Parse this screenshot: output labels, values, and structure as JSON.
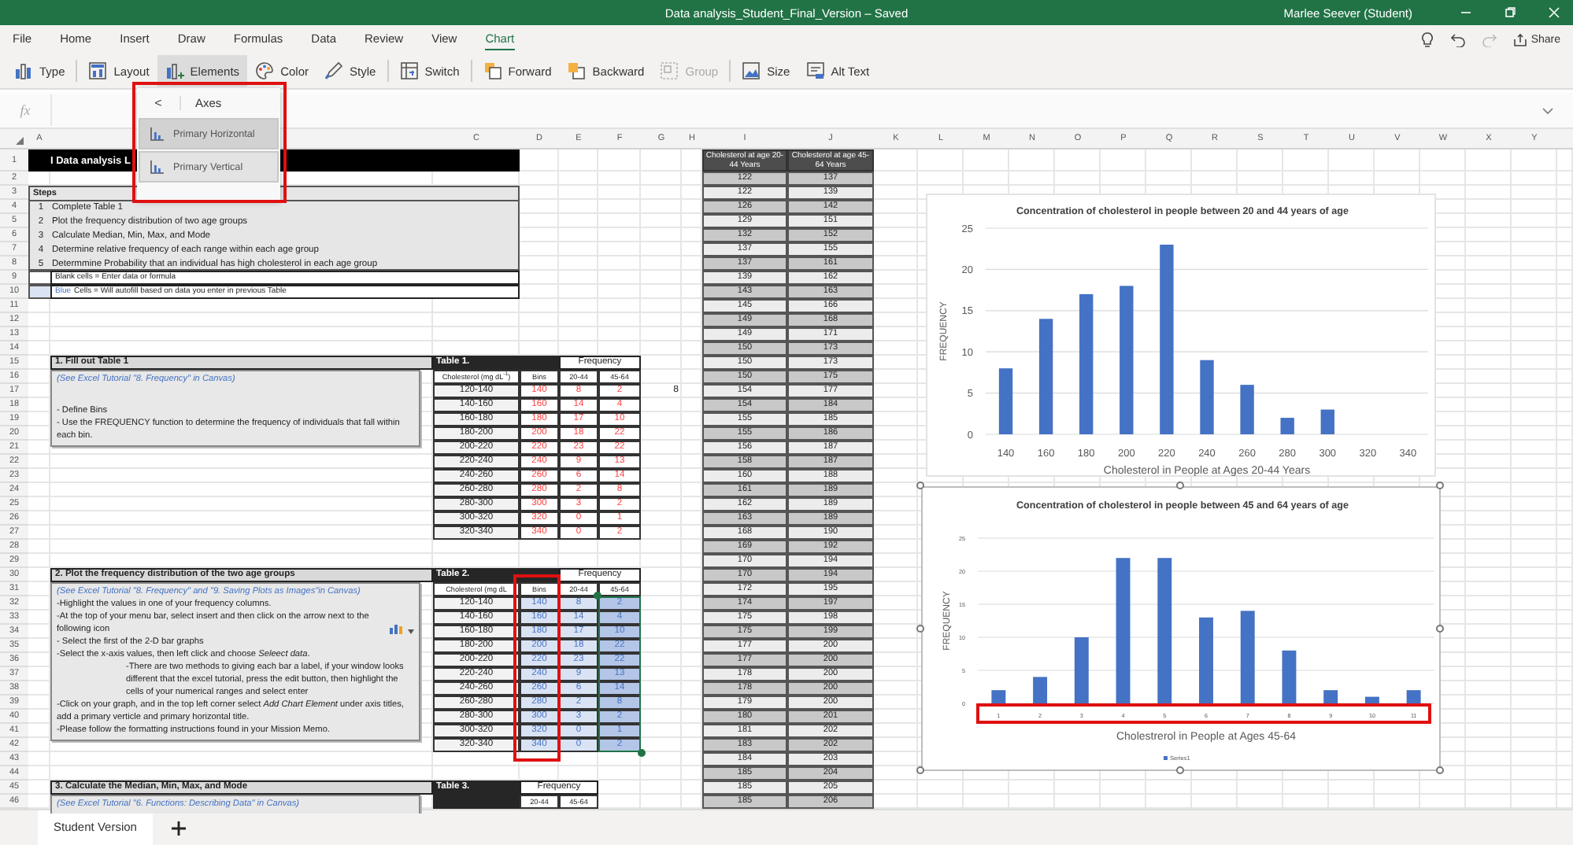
{
  "window": {
    "title": "Data analysis_Student_Final_Version – Saved",
    "user": "Marlee Seever (Student)"
  },
  "menu_tabs": [
    {
      "label": "File",
      "selected": false
    },
    {
      "label": "Home",
      "selected": false
    },
    {
      "label": "Insert",
      "selected": false
    },
    {
      "label": "Draw",
      "selected": false
    },
    {
      "label": "Formulas",
      "selected": false
    },
    {
      "label": "Data",
      "selected": false
    },
    {
      "label": "Review",
      "selected": false
    },
    {
      "label": "View",
      "selected": false
    },
    {
      "label": "Chart",
      "selected": true
    }
  ],
  "share": "Share",
  "ribbon": [
    {
      "label": "Type",
      "kind": "type",
      "active": false,
      "disabled": false
    },
    {
      "label": "Layout",
      "kind": "layout",
      "active": false,
      "disabled": false
    },
    {
      "label": "Elements",
      "kind": "elements",
      "active": true,
      "disabled": false
    },
    {
      "label": "Color",
      "kind": "color",
      "active": false,
      "disabled": false
    },
    {
      "label": "Style",
      "kind": "style",
      "active": false,
      "disabled": false
    },
    {
      "label": "Switch",
      "kind": "switch",
      "active": false,
      "disabled": false
    },
    {
      "label": "Forward",
      "kind": "forward",
      "active": false,
      "disabled": false
    },
    {
      "label": "Backward",
      "kind": "backward",
      "active": false,
      "disabled": false
    },
    {
      "label": "Group",
      "kind": "group",
      "active": false,
      "disabled": true
    },
    {
      "label": "Size",
      "kind": "size",
      "active": false,
      "disabled": false
    },
    {
      "label": "Alt Text",
      "kind": "alttext",
      "active": false,
      "disabled": false
    }
  ],
  "formula_bar": {
    "label": "fx"
  },
  "dropdown": {
    "back": "<",
    "title": "Axes",
    "items": [
      {
        "label": "Primary Horizontal",
        "selected": true
      },
      {
        "label": "Primary Vertical",
        "selected": false
      }
    ]
  },
  "column_headers": [
    "A",
    "C",
    "D",
    "E",
    "F",
    "G",
    "H",
    "I",
    "J",
    "K",
    "L",
    "M",
    "N",
    "O",
    "P",
    "Q",
    "R",
    "S",
    "T",
    "U",
    "V",
    "W",
    "X",
    "Y"
  ],
  "row_numbers": [
    "1",
    "2",
    "3",
    "4",
    "5",
    "6",
    "7",
    "8",
    "9",
    "10",
    "11",
    "12",
    "13",
    "14",
    "15",
    "16",
    "17",
    "18",
    "19",
    "20",
    "21",
    "22",
    "23",
    "24",
    "25",
    "26",
    "27",
    "28",
    "29",
    "30",
    "31",
    "32",
    "33",
    "34",
    "35",
    "36",
    "37",
    "38",
    "39",
    "40",
    "41",
    "42",
    "43",
    "44",
    "45",
    "46"
  ],
  "sheet_title": "I Data analysis L",
  "steps": {
    "heading": "Steps",
    "items": [
      {
        "number": "1",
        "text": "Complete Table 1"
      },
      {
        "number": "2",
        "text": "Plot the frequency distribution of two age groups"
      },
      {
        "number": "3",
        "text": "Calculate Median, Min, Max, and Mode"
      },
      {
        "number": "4",
        "text": "Determine relative frequency of each range within each age group"
      },
      {
        "number": "5",
        "text": "Determmine Probability that an individual has high cholesterol in each age group"
      }
    ]
  },
  "legend": [
    {
      "color": "#ffffff",
      "text": "Blank cells = Enter data or formula"
    },
    {
      "color": "#dae3f3",
      "highlight": "Blue",
      "text": "Cells = Will autofill based on data you enter in previous Table"
    }
  ],
  "sections": [
    {
      "heading": "1. Fill out Table 1",
      "note": "(See Excel Tutorial \"8. Frequency\" in Canvas)",
      "lines": [
        {
          "kind": "plain",
          "text": "- Define Bins"
        },
        {
          "kind": "plain",
          "text": "- Use the FREQUENCY function to determine the frequency of individuals that fall within each bin."
        }
      ]
    },
    {
      "heading": "2. Plot the frequency distribution of the two age groups",
      "note": "(See Excel Tutorial \"8. Frequency\" and \"9. Saving Plots as Images\"in Canvas)",
      "lines": [
        {
          "kind": "plain",
          "text": "-Highlight the values in one of your frequency columns."
        },
        {
          "kind": "icon",
          "text": "-At the top of your menu bar, select insert and then click on the arrow next to the following icon"
        },
        {
          "kind": "plain",
          "text": "- Select the first of the 2-D bar graphs"
        },
        {
          "kind": "plain",
          "text": "-Select the x-axis values, then left click and choose *Seleect data*."
        },
        {
          "kind": "indent",
          "text": "-There are two methods to giving each bar a label, if your window looks different that the excel tutorial, press the edit button, then highlight the cells of your numerical ranges and select enter"
        },
        {
          "kind": "plain",
          "text": "-Click on your graph, and in the top left corner select *Add Chart Element* under axis titles, add a primary verticle and primary horizontal title."
        },
        {
          "kind": "plain",
          "text": "-Please follow the formatting instructions found in your Mission Memo."
        }
      ]
    },
    {
      "heading": "3. Calculate the Median, Min, Max, and Mode",
      "note": "(See Excel Tutorial \"6. Functions: Describing Data\" in Canvas)"
    }
  ],
  "tables": [
    {
      "title": "Table 1.",
      "group": "Frequency",
      "kind": "entry",
      "columns": [
        {
          "label": "Cholesterol (mg dL$^{-1}$)",
          "selected": false
        },
        {
          "label": "Bins",
          "selected": false
        },
        {
          "label": "20-44",
          "selected": false
        },
        {
          "label": "45-64",
          "selected": false
        }
      ],
      "rows": [
        [
          "120-140",
          "140",
          "8",
          "2"
        ],
        [
          "140-160",
          "160",
          "14",
          "4"
        ],
        [
          "160-180",
          "180",
          "17",
          "10"
        ],
        [
          "180-200",
          "200",
          "18",
          "22"
        ],
        [
          "200-220",
          "220",
          "23",
          "22"
        ],
        [
          "220-240",
          "240",
          "9",
          "13"
        ],
        [
          "240-260",
          "260",
          "6",
          "14"
        ],
        [
          "260-280",
          "280",
          "2",
          "8"
        ],
        [
          "280-300",
          "300",
          "3",
          "2"
        ],
        [
          "300-320",
          "320",
          "0",
          "1"
        ],
        [
          "320-340",
          "340",
          "0",
          "2"
        ]
      ]
    },
    {
      "title": "Table 2.",
      "group": "Frequency",
      "kind": "autofill",
      "columns": [
        {
          "label": "Cholesterol (mg dL",
          "selected": false
        },
        {
          "label": "Bins",
          "selected": false
        },
        {
          "label": "20-44",
          "selected": false
        },
        {
          "label": "45-64",
          "selected": true
        }
      ],
      "rows": [
        [
          "120-140",
          "140",
          "8",
          "2"
        ],
        [
          "140-160",
          "160",
          "14",
          "4"
        ],
        [
          "160-180",
          "180",
          "17",
          "10"
        ],
        [
          "180-200",
          "200",
          "18",
          "22"
        ],
        [
          "200-220",
          "220",
          "23",
          "22"
        ],
        [
          "220-240",
          "240",
          "9",
          "13"
        ],
        [
          "240-260",
          "260",
          "6",
          "14"
        ],
        [
          "260-280",
          "280",
          "2",
          "8"
        ],
        [
          "280-300",
          "300",
          "3",
          "2"
        ],
        [
          "300-320",
          "320",
          "0",
          "1"
        ],
        [
          "320-340",
          "340",
          "0",
          "2"
        ]
      ]
    },
    {
      "title": "Table 3.",
      "group": "Frequency",
      "kind": "summary",
      "columns": [
        {
          "label": "20-44"
        },
        {
          "label": "45-64"
        }
      ]
    }
  ],
  "stray_value": "8",
  "data_columns": {
    "headers": [
      "Cholesterol at age 20-44 Years",
      "Cholesterol at age 45-64 Years"
    ],
    "rows": [
      [
        "122",
        "137"
      ],
      [
        "122",
        "139"
      ],
      [
        "126",
        "142"
      ],
      [
        "129",
        "151"
      ],
      [
        "132",
        "152"
      ],
      [
        "137",
        "155"
      ],
      [
        "137",
        "161"
      ],
      [
        "139",
        "162"
      ],
      [
        "143",
        "163"
      ],
      [
        "145",
        "166"
      ],
      [
        "149",
        "168"
      ],
      [
        "149",
        "171"
      ],
      [
        "150",
        "173"
      ],
      [
        "150",
        "173"
      ],
      [
        "150",
        "175"
      ],
      [
        "154",
        "177"
      ],
      [
        "154",
        "184"
      ],
      [
        "155",
        "185"
      ],
      [
        "155",
        "186"
      ],
      [
        "156",
        "187"
      ],
      [
        "158",
        "187"
      ],
      [
        "160",
        "188"
      ],
      [
        "161",
        "189"
      ],
      [
        "162",
        "189"
      ],
      [
        "163",
        "189"
      ],
      [
        "168",
        "190"
      ],
      [
        "169",
        "192"
      ],
      [
        "170",
        "194"
      ],
      [
        "170",
        "194"
      ],
      [
        "172",
        "195"
      ],
      [
        "174",
        "197"
      ],
      [
        "175",
        "198"
      ],
      [
        "175",
        "199"
      ],
      [
        "177",
        "200"
      ],
      [
        "177",
        "200"
      ],
      [
        "178",
        "200"
      ],
      [
        "178",
        "200"
      ],
      [
        "179",
        "200"
      ],
      [
        "180",
        "201"
      ],
      [
        "181",
        "202"
      ],
      [
        "183",
        "202"
      ],
      [
        "184",
        "203"
      ],
      [
        "185",
        "204"
      ],
      [
        "185",
        "205"
      ],
      [
        "185",
        "206"
      ]
    ]
  },
  "charts": [
    {
      "selected": false,
      "chart_data": {
        "type": "bar",
        "title": "Concentration of cholesterol in people between 20 and 44 years of age",
        "xlabel": "Cholesterol in People at Ages 20-44 Years",
        "ylabel": "FREQUENCY",
        "categories": [
          "140",
          "160",
          "180",
          "200",
          "220",
          "240",
          "260",
          "280",
          "300",
          "320",
          "340"
        ],
        "values": [
          8,
          14,
          17,
          18,
          23,
          9,
          6,
          2,
          3,
          0,
          0
        ],
        "grid": true,
        "ylim": [
          0,
          25
        ],
        "yticks": [
          0,
          5,
          10,
          15,
          20,
          25
        ]
      }
    },
    {
      "selected": true,
      "chart_data": {
        "type": "bar",
        "title": "Concentration of cholesterol in people between 45 and 64 years of age",
        "xlabel": "Cholestrerol in People at Ages 45-64",
        "ylabel": "FREQUENCY",
        "categories": [
          "1",
          "2",
          "3",
          "4",
          "5",
          "6",
          "7",
          "8",
          "9",
          "10",
          "11"
        ],
        "series": [
          {
            "name": "Series1",
            "color": "#4472c4",
            "values": [
              2,
              4,
              10,
              22,
              22,
              13,
              14,
              8,
              2,
              1,
              2
            ]
          }
        ],
        "grid": true,
        "ylim": [
          0,
          25
        ],
        "yticks": [
          0,
          5,
          10,
          15,
          20,
          25
        ]
      }
    }
  ],
  "sheet_tabs": [
    {
      "label": "Student Version",
      "selected": true
    }
  ]
}
